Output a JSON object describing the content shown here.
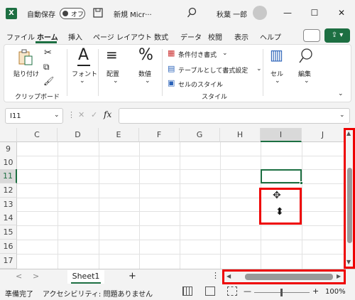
{
  "title_bar": {
    "app_icon": "X",
    "autosave_label": "自動保存",
    "autosave_state": "オフ",
    "doc_title": "新規 Micr···",
    "user_name": "秋葉 一郎",
    "minimize": "—",
    "maximize": "☐",
    "close": "✕"
  },
  "menu": {
    "items": [
      "ファイル",
      "ホーム",
      "挿入",
      "ページ レイアウト",
      "数式",
      "データ",
      "校閲",
      "表示",
      "ヘルプ"
    ],
    "active": "ホーム"
  },
  "ribbon": {
    "paste_label": "貼り付け",
    "clipboard_group": "クリップボード",
    "font_label": "フォント",
    "alignment_label": "配置",
    "number_label": "数値",
    "conditional_format": "条件付き書式",
    "format_as_table": "テーブルとして書式設定",
    "cell_styles": "セルのスタイル",
    "styles_group": "スタイル",
    "cells_label": "セル",
    "edit_label": "編集"
  },
  "formula_bar": {
    "name_box": "I11",
    "cancel": "✕",
    "enter": "✓",
    "fx": "fx",
    "formula": ""
  },
  "grid": {
    "columns": [
      "C",
      "D",
      "E",
      "F",
      "G",
      "H",
      "I",
      "J"
    ],
    "rows": [
      "9",
      "10",
      "11",
      "12",
      "13",
      "14",
      "15",
      "16",
      "17"
    ],
    "selected_cell": "I11"
  },
  "sheet_tabs": {
    "prev": "<",
    "next": ">",
    "sheets": [
      "Sheet1"
    ],
    "add": "+",
    "more": "⋮"
  },
  "status_bar": {
    "ready": "準備完了",
    "accessibility": "アクセシビリティ: 問題ありません",
    "zoom_minus": "—",
    "zoom_plus": "+",
    "zoom_level": "100%",
    "zoom_percent": 100
  },
  "colors": {
    "accent": "#1d6f42",
    "highlight": "#e00000"
  },
  "icons": [
    "excel-icon",
    "save-icon",
    "search-icon",
    "avatar",
    "comment-icon",
    "share-icon",
    "paste-icon",
    "cut-icon",
    "copy-icon",
    "format-painter-icon",
    "font-icon",
    "alignment-icon",
    "percent-icon",
    "table-icon",
    "cells-icon",
    "search-edit-icon",
    "move-cursor-icon",
    "fill-handle-icon"
  ]
}
